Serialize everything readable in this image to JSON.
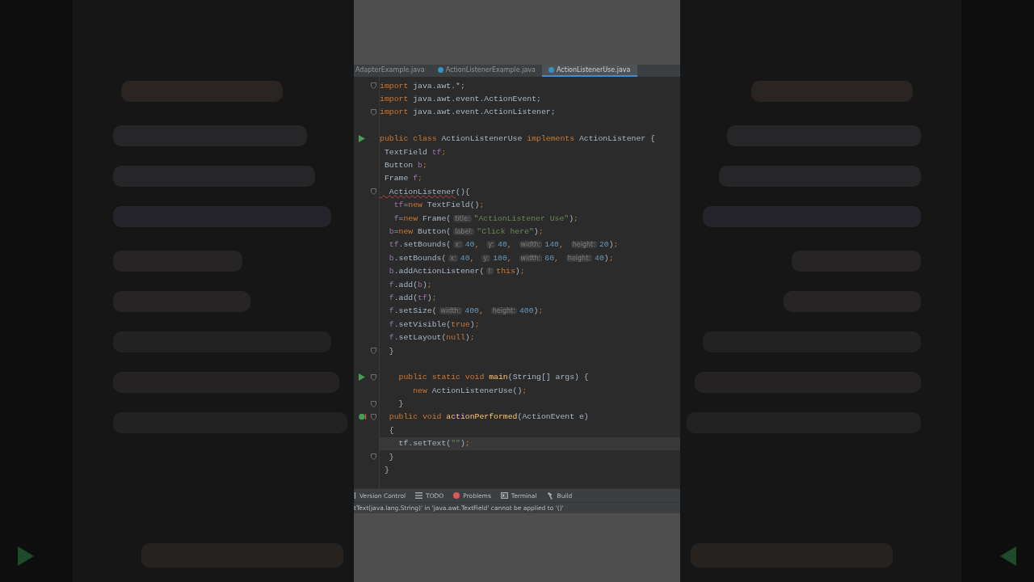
{
  "tabs": [
    {
      "label": "AdapterExample.java",
      "selected": false
    },
    {
      "label": "ActionListenerExample.java",
      "selected": false
    },
    {
      "label": "ActionListenerUse.java",
      "selected": true
    }
  ],
  "editor": {
    "lines": [
      {
        "fold": true,
        "current": false,
        "tokens": [
          {
            "kind": "keyword",
            "text": "import "
          },
          {
            "kind": "plain",
            "text": "java.awt.*;"
          }
        ]
      },
      {
        "fold": false,
        "current": false,
        "tokens": [
          {
            "kind": "keyword",
            "text": "import "
          },
          {
            "kind": "plain",
            "text": "java.awt.event.ActionEvent;"
          }
        ]
      },
      {
        "fold": true,
        "current": false,
        "tokens": [
          {
            "kind": "keyword",
            "text": "import "
          },
          {
            "kind": "plain",
            "text": "java.awt.event.ActionListener;"
          }
        ]
      },
      {
        "fold": false,
        "current": false
      },
      {
        "fold": false,
        "current": false,
        "kind": "run",
        "tokens": [
          {
            "kind": "keyword",
            "text": "public class "
          },
          {
            "kind": "plain",
            "text": "ActionListenerUse "
          },
          {
            "kind": "keyword",
            "text": "implements "
          },
          {
            "kind": "plain",
            "text": "ActionListener {"
          }
        ]
      },
      {
        "fold": false,
        "current": false,
        "tokens": [
          {
            "kind": "plain",
            "text": " TextField "
          },
          {
            "kind": "field",
            "text": "tf"
          },
          {
            "kind": "keyword",
            "text": ";"
          }
        ]
      },
      {
        "fold": false,
        "current": false,
        "tokens": [
          {
            "kind": "plain",
            "text": " Button "
          },
          {
            "kind": "field",
            "text": "b"
          },
          {
            "kind": "keyword",
            "text": ";"
          }
        ]
      },
      {
        "fold": false,
        "current": false,
        "tokens": [
          {
            "kind": "plain",
            "text": " Frame "
          },
          {
            "kind": "field",
            "text": "f"
          },
          {
            "kind": "keyword",
            "text": ";"
          }
        ]
      },
      {
        "fold": true,
        "current": false,
        "tokens": [
          {
            "kind": "error",
            "text": "  ActionListener"
          },
          {
            "kind": "plain",
            "text": "(){"
          }
        ]
      },
      {
        "fold": false,
        "current": false,
        "tokens": [
          {
            "kind": "field",
            "text": "   tf"
          },
          {
            "kind": "plain",
            "text": "="
          },
          {
            "kind": "keyword",
            "text": "new "
          },
          {
            "kind": "plain",
            "text": "TextField()"
          },
          {
            "kind": "keyword",
            "text": ";"
          }
        ]
      },
      {
        "fold": false,
        "current": false,
        "tokens": [
          {
            "kind": "field",
            "text": "   f"
          },
          {
            "kind": "plain",
            "text": "="
          },
          {
            "kind": "keyword",
            "text": "new "
          },
          {
            "kind": "plain",
            "text": "Frame("
          },
          {
            "kind": "hint",
            "text": "title:"
          },
          {
            "kind": "string",
            "text": "\"ActionListener Use\""
          },
          {
            "kind": "plain",
            "text": ")"
          },
          {
            "kind": "keyword",
            "text": ";"
          }
        ]
      },
      {
        "fold": false,
        "current": false,
        "tokens": [
          {
            "kind": "field",
            "text": "  b"
          },
          {
            "kind": "plain",
            "text": "="
          },
          {
            "kind": "keyword",
            "text": "new "
          },
          {
            "kind": "plain",
            "text": "Button("
          },
          {
            "kind": "hint",
            "text": "label:"
          },
          {
            "kind": "string",
            "text": "\"Click here\""
          },
          {
            "kind": "plain",
            "text": ")"
          },
          {
            "kind": "keyword",
            "text": ";"
          }
        ]
      },
      {
        "fold": false,
        "current": false,
        "tokens": [
          {
            "kind": "field",
            "text": "  tf"
          },
          {
            "kind": "plain",
            "text": ".setBounds("
          },
          {
            "kind": "hint",
            "text": "x:"
          },
          {
            "kind": "number",
            "text": "40"
          },
          {
            "kind": "keyword",
            "text": ", "
          },
          {
            "kind": "hint",
            "text": "y:"
          },
          {
            "kind": "number",
            "text": "40"
          },
          {
            "kind": "keyword",
            "text": ", "
          },
          {
            "kind": "hint",
            "text": "width:"
          },
          {
            "kind": "number",
            "text": "140"
          },
          {
            "kind": "keyword",
            "text": ", "
          },
          {
            "kind": "hint",
            "text": "height:"
          },
          {
            "kind": "number",
            "text": "20"
          },
          {
            "kind": "plain",
            "text": ")"
          },
          {
            "kind": "keyword",
            "text": ";"
          }
        ]
      },
      {
        "fold": false,
        "current": false,
        "tokens": [
          {
            "kind": "field",
            "text": "  b"
          },
          {
            "kind": "plain",
            "text": ".setBounds("
          },
          {
            "kind": "hint",
            "text": "x:"
          },
          {
            "kind": "number",
            "text": "40"
          },
          {
            "kind": "keyword",
            "text": ", "
          },
          {
            "kind": "hint",
            "text": "y:"
          },
          {
            "kind": "number",
            "text": "100"
          },
          {
            "kind": "keyword",
            "text": ", "
          },
          {
            "kind": "hint",
            "text": "width:"
          },
          {
            "kind": "number",
            "text": "60"
          },
          {
            "kind": "keyword",
            "text": ", "
          },
          {
            "kind": "hint",
            "text": "height:"
          },
          {
            "kind": "number",
            "text": "40"
          },
          {
            "kind": "plain",
            "text": ")"
          },
          {
            "kind": "keyword",
            "text": ";"
          }
        ]
      },
      {
        "fold": false,
        "current": false,
        "tokens": [
          {
            "kind": "field",
            "text": "  b"
          },
          {
            "kind": "plain",
            "text": ".addActionListener("
          },
          {
            "kind": "hint",
            "text": "l:"
          },
          {
            "kind": "keyword",
            "text": "this"
          },
          {
            "kind": "plain",
            "text": ")"
          },
          {
            "kind": "keyword",
            "text": ";"
          }
        ]
      },
      {
        "fold": false,
        "current": false,
        "tokens": [
          {
            "kind": "field",
            "text": "  f"
          },
          {
            "kind": "plain",
            "text": ".add("
          },
          {
            "kind": "field",
            "text": "b"
          },
          {
            "kind": "plain",
            "text": ")"
          },
          {
            "kind": "keyword",
            "text": ";"
          }
        ]
      },
      {
        "fold": false,
        "current": false,
        "tokens": [
          {
            "kind": "field",
            "text": "  f"
          },
          {
            "kind": "plain",
            "text": ".add("
          },
          {
            "kind": "field",
            "text": "tf"
          },
          {
            "kind": "plain",
            "text": ")"
          },
          {
            "kind": "keyword",
            "text": ";"
          }
        ]
      },
      {
        "fold": false,
        "current": false,
        "tokens": [
          {
            "kind": "field",
            "text": "  f"
          },
          {
            "kind": "plain",
            "text": ".setSize("
          },
          {
            "kind": "hint",
            "text": "width:"
          },
          {
            "kind": "number",
            "text": "400"
          },
          {
            "kind": "keyword",
            "text": ", "
          },
          {
            "kind": "hint",
            "text": "height:"
          },
          {
            "kind": "number",
            "text": "400"
          },
          {
            "kind": "plain",
            "text": ")"
          },
          {
            "kind": "keyword",
            "text": ";"
          }
        ]
      },
      {
        "fold": false,
        "current": false,
        "tokens": [
          {
            "kind": "field",
            "text": "  f"
          },
          {
            "kind": "plain",
            "text": ".setVisible("
          },
          {
            "kind": "keyword",
            "text": "true"
          },
          {
            "kind": "plain",
            "text": ")"
          },
          {
            "kind": "keyword",
            "text": ";"
          }
        ]
      },
      {
        "fold": false,
        "current": false,
        "tokens": [
          {
            "kind": "field",
            "text": "  f"
          },
          {
            "kind": "plain",
            "text": ".setLayout("
          },
          {
            "kind": "keyword",
            "text": "null"
          },
          {
            "kind": "plain",
            "text": ")"
          },
          {
            "kind": "keyword",
            "text": ";"
          }
        ]
      },
      {
        "fold": true,
        "current": false,
        "tokens": [
          {
            "kind": "plain",
            "text": "  }"
          }
        ]
      },
      {
        "fold": false,
        "current": false
      },
      {
        "fold": true,
        "current": false,
        "kind": "run",
        "tokens": [
          {
            "kind": "keyword",
            "text": "    public static void "
          },
          {
            "kind": "method",
            "text": "main"
          },
          {
            "kind": "plain",
            "text": "(String[] args) {"
          }
        ]
      },
      {
        "fold": false,
        "current": false,
        "tokens": [
          {
            "kind": "keyword",
            "text": "       new "
          },
          {
            "kind": "plain",
            "text": "ActionListenerUse()"
          },
          {
            "kind": "keyword",
            "text": ";"
          }
        ]
      },
      {
        "fold": true,
        "current": false,
        "tokens": [
          {
            "kind": "plain",
            "text": "    }"
          }
        ]
      },
      {
        "fold": true,
        "current": false,
        "kind": "override",
        "tokens": [
          {
            "kind": "keyword",
            "text": "  public void "
          },
          {
            "kind": "method",
            "text": "actionPerformed"
          },
          {
            "kind": "plain",
            "text": "(ActionEvent e)"
          }
        ]
      },
      {
        "fold": false,
        "current": false,
        "tokens": [
          {
            "kind": "plain",
            "text": "  {"
          }
        ]
      },
      {
        "fold": false,
        "current": true,
        "tokens": [
          {
            "kind": "plain",
            "text": "    tf.setText("
          },
          {
            "kind": "string",
            "text": "\"\""
          },
          {
            "kind": "plain",
            "text": ")"
          },
          {
            "kind": "keyword",
            "text": ";"
          }
        ]
      },
      {
        "fold": true,
        "current": false,
        "tokens": [
          {
            "kind": "plain",
            "text": "  }"
          }
        ]
      },
      {
        "fold": false,
        "current": false,
        "tokens": [
          {
            "kind": "plain",
            "text": " }"
          }
        ]
      }
    ]
  },
  "tool_windows": [
    {
      "kind": "vcs",
      "label": "Version Control"
    },
    {
      "kind": "todo",
      "label": "TODO"
    },
    {
      "kind": "problems",
      "label": "Problems"
    },
    {
      "kind": "terminal",
      "label": "Terminal"
    },
    {
      "kind": "build",
      "label": "Build"
    }
  ],
  "status_bar": {
    "message": "tText(java.lang.String)' in 'java.awt.TextField' cannot be applied to '()'"
  }
}
